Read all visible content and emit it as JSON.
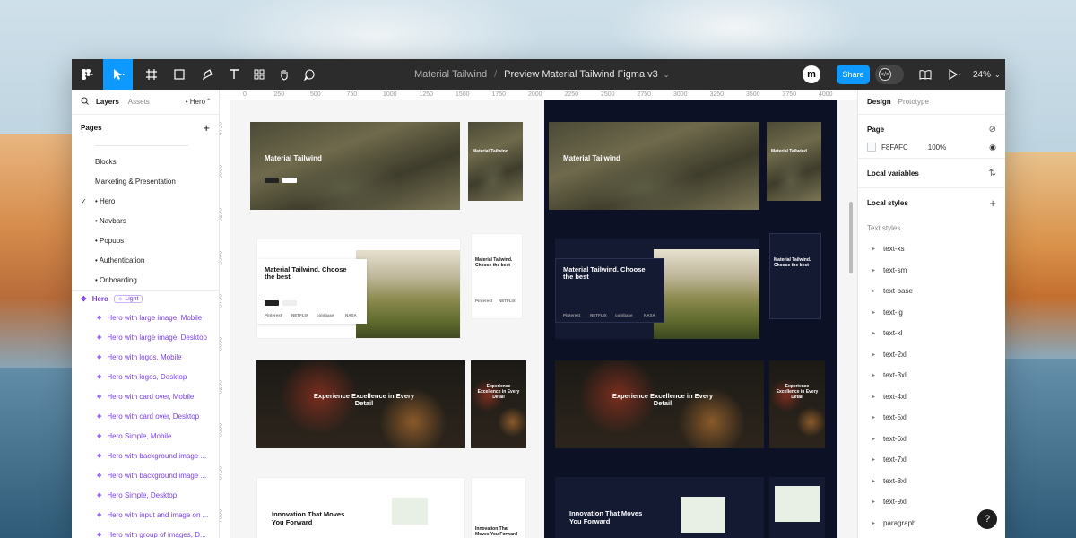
{
  "toolbar": {
    "breadcrumb_team": "Material Tailwind",
    "breadcrumb_sep": "/",
    "file_name": "Preview Material Tailwind Figma v3",
    "avatar_letter": "m",
    "share_label": "Share",
    "zoom_label": "24%"
  },
  "left_panel": {
    "tab_layers": "Layers",
    "tab_assets": "Assets",
    "current_page": "• Hero",
    "pages_title": "Pages",
    "add_icon": "+",
    "pages": [
      "Blocks",
      "Marketing & Presentation",
      "• Hero",
      "• Navbars",
      "• Popups",
      "• Authentication",
      "• Onboarding"
    ],
    "selected_page_check": "✓",
    "layer_group": "Hero",
    "layer_group_badge": "Light",
    "layers": [
      "Hero with large image, Mobile",
      "Hero with large image, Desktop",
      "Hero with logos, Mobile",
      "Hero with logos, Desktop",
      "Hero with card over, Mobile",
      "Hero with card over, Desktop",
      "Hero Simple, Mobile",
      "Hero with background image ...",
      "Hero with background image ...",
      "Hero Simple, Desktop",
      "Hero with input and image on ...",
      "Hero with group of images, D..."
    ]
  },
  "canvas": {
    "ruler_x": [
      "0",
      "250",
      "500",
      "750",
      "1000",
      "1250",
      "1500",
      "1750",
      "2000",
      "2250",
      "2500",
      "2750",
      "3000",
      "3250",
      "3500",
      "3750",
      "4000"
    ],
    "ruler_y": [
      "4750",
      "5000",
      "5250",
      "5500",
      "5750",
      "6000",
      "6250",
      "6500",
      "6750",
      "7000"
    ],
    "frame_texts": {
      "hero_title": "Material Tailwind",
      "logos_title": "Material Tailwind. Choose the best",
      "excellence_title": "Experience Excellence in Every Detail",
      "innovation_title": "Innovation That Moves You Forward",
      "logo_pinterest": "Pinterest",
      "logo_netflix": "NETFLIX",
      "logo_coinbase": "coinbase",
      "logo_nasa": "NASA"
    }
  },
  "right_panel": {
    "tab_design": "Design",
    "tab_prototype": "Prototype",
    "page_title": "Page",
    "page_color": "F8FAFC",
    "page_opacity": "100%",
    "local_variables": "Local variables",
    "local_styles": "Local styles",
    "text_styles_label": "Text styles",
    "text_styles": [
      "text-xs",
      "text-sm",
      "text-base",
      "text-lg",
      "text-xl",
      "text-2xl",
      "text-3xl",
      "text-4xl",
      "text-5xl",
      "text-6xl",
      "text-7xl",
      "text-8xl",
      "text-9xl",
      "paragraph"
    ]
  },
  "help_label": "?",
  "colors": {
    "toolbar_bg": "#2c2c2c",
    "accent_blue": "#0d99ff",
    "layer_purple": "#7b3fe4",
    "dark_frame": "#0d1126"
  },
  "icons": [
    "figma-menu-icon",
    "move-tool-icon",
    "frame-tool-icon",
    "shape-tool-icon",
    "pen-tool-icon",
    "text-tool-icon",
    "components-icon",
    "hand-tool-icon",
    "comment-icon",
    "dev-mode-icon",
    "library-icon",
    "present-icon",
    "search-icon",
    "eye-icon",
    "adjust-icon",
    "help-icon"
  ]
}
